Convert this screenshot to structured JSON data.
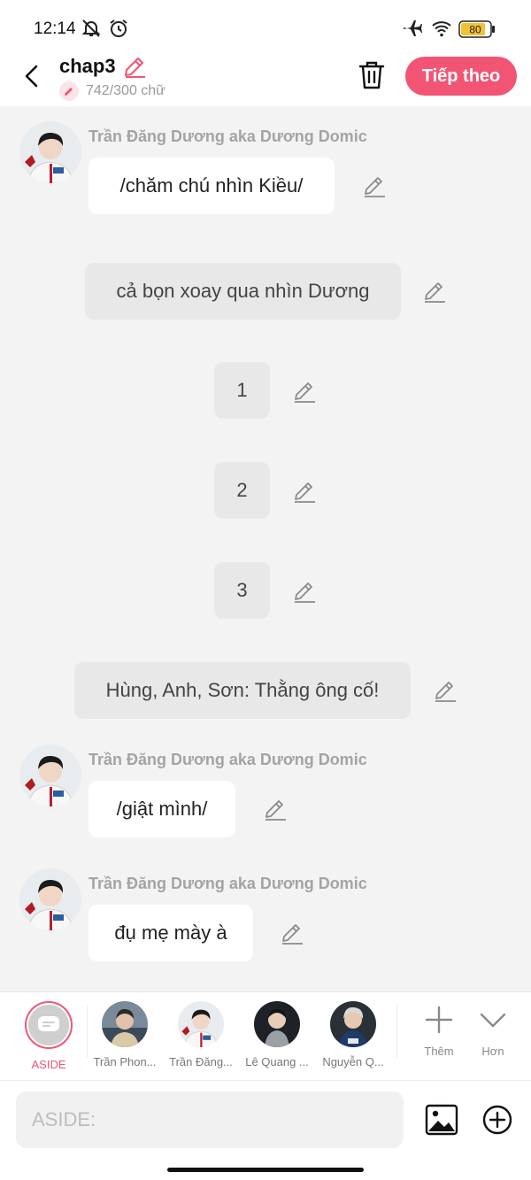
{
  "status_bar": {
    "time": "12:14",
    "battery": "80"
  },
  "header": {
    "title": "chap3",
    "word_count": "742/300 chữ",
    "next_label": "Tiếp theo"
  },
  "messages": [
    {
      "type": "character",
      "speaker": "Trần Đăng Dương aka Dương Domic",
      "text": "/chăm chú nhìn Kiều/"
    },
    {
      "type": "aside",
      "text": "cả bọn xoay qua nhìn Dương"
    },
    {
      "type": "aside",
      "text": "1"
    },
    {
      "type": "aside",
      "text": "2"
    },
    {
      "type": "aside",
      "text": "3"
    },
    {
      "type": "aside",
      "text": "Hùng, Anh, Sơn: Thằng ông cố!"
    },
    {
      "type": "character",
      "speaker": "Trần Đăng Dương aka Dương Domic",
      "text": "/giật mình/"
    },
    {
      "type": "character",
      "speaker": "Trần Đăng Dương aka Dương Domic",
      "text": "đụ mẹ mày à"
    }
  ],
  "character_bar": {
    "aside_label": "ASIDE",
    "characters": [
      "Trần Phon...",
      "Trần Đăng...",
      "Lê Quang ...",
      "Nguyễn Q..."
    ],
    "more_label": "Thêm",
    "expand_label": "Hơn"
  },
  "input": {
    "placeholder": "ASIDE:"
  },
  "colors": {
    "accent": "#f25574",
    "background": "#f3f3f3",
    "bubble_white": "#ffffff",
    "bubble_grey": "#e8e8e8"
  }
}
